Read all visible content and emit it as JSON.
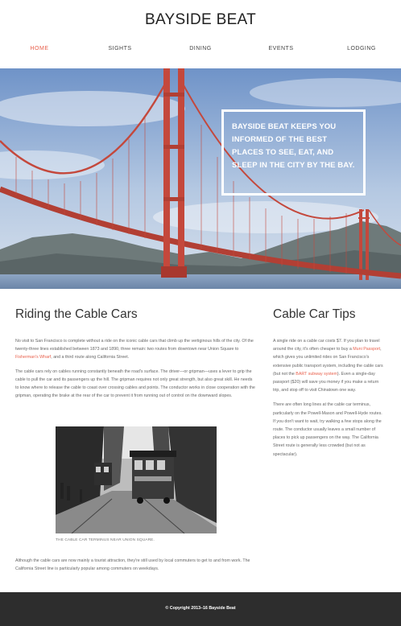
{
  "site": {
    "title": "BAYSIDE BEAT"
  },
  "nav": {
    "items": [
      {
        "label": "HOME"
      },
      {
        "label": "SIGHTS"
      },
      {
        "label": "DINING"
      },
      {
        "label": "EVENTS"
      },
      {
        "label": "LODGING"
      }
    ],
    "active_color": "#e8604c"
  },
  "hero": {
    "text": "BAYSIDE BEAT KEEPS YOU INFORMED OF THE BEST PLACES TO SEE, EAT, AND SLEEP IN THE CITY BY THE BAY."
  },
  "main": {
    "heading": "Riding the Cable Cars",
    "p1_before": "No visit to San Francisco is complete without a ride on the iconic cable cars that climb up the vertiginous hills of the city. Of the twenty-three lines established between 1873 and 1890, three remain: two routes from downtown near Union Square to ",
    "p1_link": "Fisherman's Wharf",
    "p1_after": ", and a third route along California Street.",
    "p2": "The cable cars rely on cables running constantly beneath the road's surface. The driver—or gripman—uses a lever to grip the cable to pull the car and its passengers up the hill. The gripman requires not only great strength, but also great skill. He needs to know where to release the cable to coast over crossing cables and points. The conductor works in close cooperation with the gripman, operating the brake at the rear of the car to prevent it from running out of control on the downward slopes.",
    "caption": "THE CABLE CAR TERMINUS NEAR UNION SQUARE.",
    "p3": "Although the cable cars are now mainly a tourist attraction, they're still used by local commuters to get to and from work. The California Street line is particularly popular among commuters on weekdays."
  },
  "sidebar": {
    "heading": "Cable Car Tips",
    "p1_a": "A single ride on a cable car costs $7. If you plan to travel around the city, it's often cheaper to buy a ",
    "p1_link1": "Muni Passport",
    "p1_b": ", which gives you unlimited rides on San Francisco's extensive public transport system, including the cable cars (but not the ",
    "p1_link2": "BART subway system",
    "p1_c": "). Even a single-day passport ($20) will save you money if you make a return trip, and stop off to visit Chinatown one way.",
    "p2": "There are often long lines at the cable car terminus, particularly on the Powell-Mason and Powell-Hyde routes. If you don't want to wait, try walking a few stops along the route. The conductor usually leaves a small number of places to pick up passengers on the way. The California Street route is generally less crowded (but not as spectacular)."
  },
  "footer": {
    "copyright": "© Copyright 2013–16 Bayside Beat"
  },
  "colors": {
    "accent": "#e8604c",
    "footer_bg": "#2d2d2d",
    "bridge": "#c4483c"
  },
  "icons": [
    "golden-gate-bridge-photo",
    "cable-car-photo"
  ]
}
